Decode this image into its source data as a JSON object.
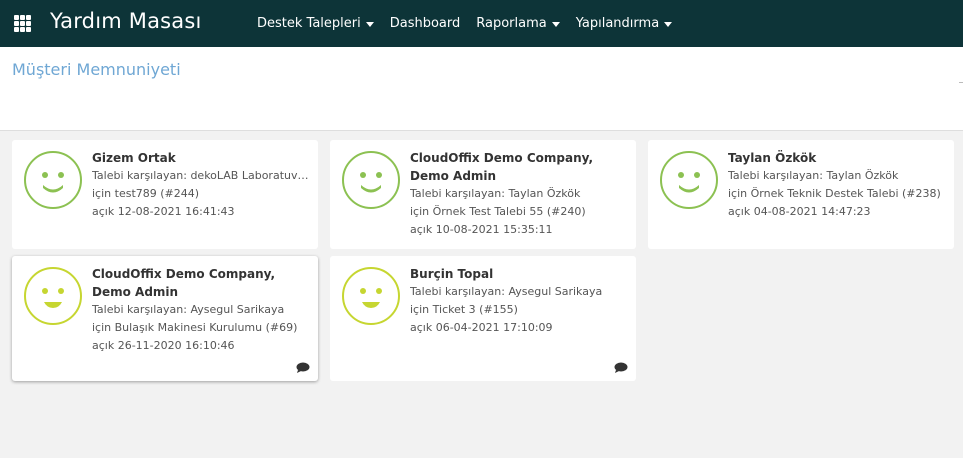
{
  "header": {
    "app_title": "Yardım Masası",
    "nav": [
      {
        "label": "Destek Talepleri",
        "dropdown": true
      },
      {
        "label": "Dashboard",
        "dropdown": false
      },
      {
        "label": "Raporlama",
        "dropdown": true
      },
      {
        "label": "Yapılandırma",
        "dropdown": true
      }
    ],
    "background_color": "#0d3438"
  },
  "page": {
    "title": "Müşteri Memnuniyeti",
    "title_color": "#6fa7d4"
  },
  "cards": [
    {
      "name": "Gizem Ortak",
      "line1": "Talebi karşılayan: dekoLAB Laboratuvar...",
      "line2": "için test789 (#244)",
      "line3": "açık 12-08-2021 16:41:43",
      "face": "happy-face-icon",
      "face_color": "#8cc152",
      "has_comment": false
    },
    {
      "name": "CloudOffix Demo Company, Demo Admin",
      "line1": "Talebi karşılayan: Taylan Özkök",
      "line2": "için Örnek Test Talebi 55 (#240)",
      "line3": "açık 10-08-2021 15:35:11",
      "face": "happy-face-icon",
      "face_color": "#8cc152",
      "has_comment": false
    },
    {
      "name": "Taylan Özkök",
      "line1": "Talebi karşılayan: Taylan Özkök",
      "line2": "için Örnek Teknik Destek Talebi (#238)",
      "line3": "açık 04-08-2021 14:47:23",
      "face": "happy-face-icon",
      "face_color": "#8cc152",
      "has_comment": false
    },
    {
      "name": "CloudOffix Demo Company, Demo Admin",
      "line1": "Talebi karşılayan: Aysegul Sarikaya",
      "line2": "için Bulaşık Makinesi Kurulumu (#69)",
      "line3": "açık 26-11-2020 16:10:46",
      "face": "neutral-face-icon",
      "face_color": "#c6d631",
      "has_comment": true
    },
    {
      "name": "Burçin Topal",
      "line1": "Talebi karşılayan: Aysegul Sarikaya",
      "line2": "için Ticket 3 (#155)",
      "line3": "açık 06-04-2021 17:10:09",
      "face": "neutral-face-icon",
      "face_color": "#c6d631",
      "has_comment": true
    }
  ]
}
